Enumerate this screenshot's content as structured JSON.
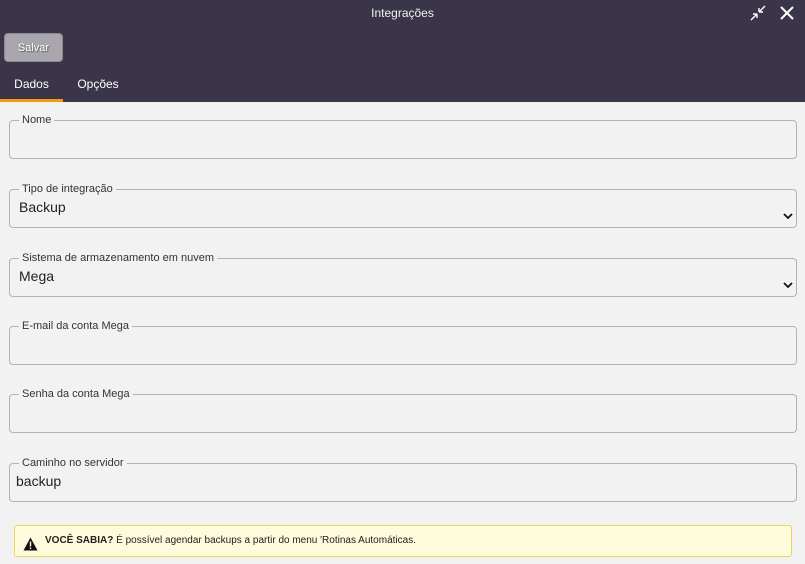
{
  "window": {
    "title": "Integrações"
  },
  "toolbar": {
    "save_label": "Salvar"
  },
  "tabs": [
    {
      "label": "Dados",
      "active": true
    },
    {
      "label": "Opções",
      "active": false
    }
  ],
  "fields": {
    "name": {
      "label": "Nome",
      "value": ""
    },
    "integration_type": {
      "label": "Tipo de integração",
      "value": "Backup"
    },
    "cloud_storage": {
      "label": "Sistema de armazenamento em nuvem",
      "value": "Mega"
    },
    "email": {
      "label": "E-mail da conta Mega",
      "value": ""
    },
    "password": {
      "label": "Senha da conta Mega",
      "value": ""
    },
    "server_path": {
      "label": "Caminho no servidor",
      "value": "backup"
    }
  },
  "tip": {
    "title": "VOCÊ SABIA?",
    "text": "É possível agendar backups a partir do menu 'Rotinas Automáticas."
  },
  "colors": {
    "header": "#3a3549",
    "tab_accent": "#f39c12",
    "tip_bg": "#fdfbdc"
  }
}
